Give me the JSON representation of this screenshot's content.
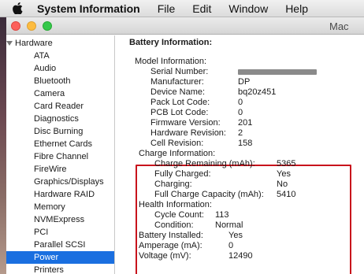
{
  "menubar": {
    "app_name": "System Information",
    "items": [
      "File",
      "Edit",
      "Window",
      "Help"
    ]
  },
  "window": {
    "title": "Mac"
  },
  "sidebar": {
    "section": "Hardware",
    "items": [
      "ATA",
      "Audio",
      "Bluetooth",
      "Camera",
      "Card Reader",
      "Diagnostics",
      "Disc Burning",
      "Ethernet Cards",
      "Fibre Channel",
      "FireWire",
      "Graphics/Displays",
      "Hardware RAID",
      "Memory",
      "NVMExpress",
      "PCI",
      "Parallel SCSI",
      "Power",
      "Printers"
    ],
    "selected": "Power"
  },
  "pane": {
    "title": "Battery Information:",
    "model_info": {
      "heading": "Model Information:",
      "rows": [
        {
          "label": "Serial Number:",
          "value": ""
        },
        {
          "label": "Manufacturer:",
          "value": "DP"
        },
        {
          "label": "Device Name:",
          "value": "bq20z451"
        },
        {
          "label": "Pack Lot Code:",
          "value": "0"
        },
        {
          "label": "PCB Lot Code:",
          "value": "0"
        },
        {
          "label": "Firmware Version:",
          "value": "201"
        },
        {
          "label": "Hardware Revision:",
          "value": "2"
        },
        {
          "label": "Cell Revision:",
          "value": "158"
        }
      ]
    },
    "charge_info": {
      "heading": "Charge Information:",
      "rows": [
        {
          "label": "Charge Remaining (mAh):",
          "value": "5365"
        },
        {
          "label": "Fully Charged:",
          "value": "Yes"
        },
        {
          "label": "Charging:",
          "value": "No"
        },
        {
          "label": "Full Charge Capacity (mAh):",
          "value": "5410"
        }
      ]
    },
    "health_info": {
      "heading": "Health Information:",
      "rows": [
        {
          "label": "Cycle Count:",
          "value": "113"
        },
        {
          "label": "Condition:",
          "value": "Normal"
        }
      ]
    },
    "summary": [
      {
        "label": "Battery Installed:",
        "value": "Yes"
      },
      {
        "label": "Amperage (mA):",
        "value": "0"
      },
      {
        "label": "Voltage (mV):",
        "value": "12490"
      }
    ]
  },
  "colors": {
    "selection": "#1a6fe0",
    "highlight_border": "#c8141c",
    "close": "#fc605b",
    "minimize": "#fdbc40",
    "maximize": "#34c84a"
  }
}
